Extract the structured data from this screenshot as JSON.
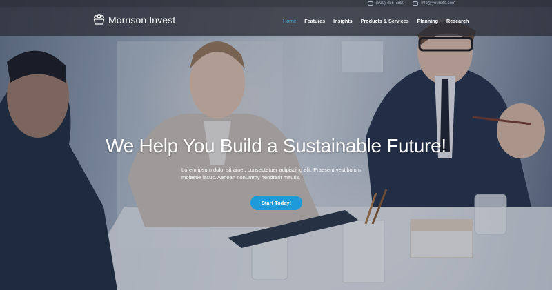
{
  "topbar": {
    "phone": "(800)-456-7890",
    "email": "info@yoursite.com"
  },
  "brand": {
    "name": "Morrison Invest",
    "logo_icon": "crown-logo-icon"
  },
  "nav": {
    "items": [
      {
        "label": "Home",
        "active": true
      },
      {
        "label": "Features"
      },
      {
        "label": "Insights"
      },
      {
        "label": "Products & Services"
      },
      {
        "label": "Planning"
      },
      {
        "label": "Research"
      }
    ]
  },
  "hero": {
    "headline": "We Help You Build a Sustainable Future!",
    "subtext": "Lorem ipsum dolor sit amet, consectetuer adipiscing elit. Praesent vestibulum molestie lacus. Aenean nonummy hendrerit mauris.",
    "cta_label": "Start Today!"
  },
  "colors": {
    "accent": "#1e9ad8",
    "nav_active": "#4aaee8",
    "header_bg": "#2d3038"
  }
}
